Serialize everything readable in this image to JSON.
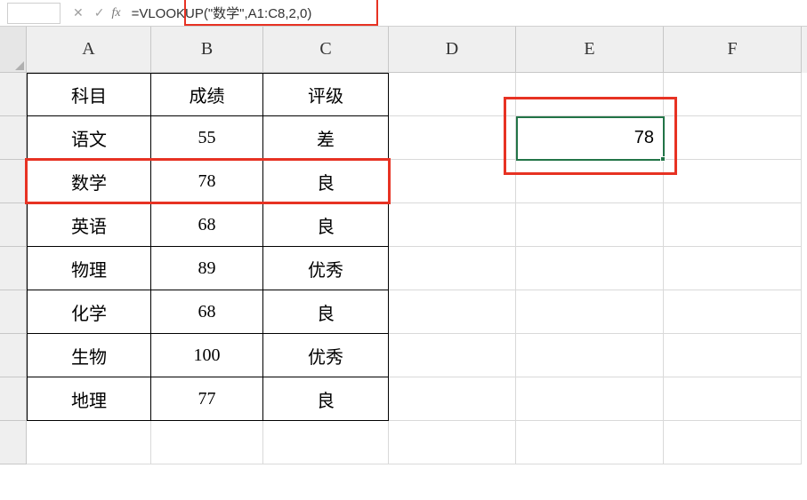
{
  "formula_bar": {
    "name_box": "",
    "formula": "=VLOOKUP(\"数学\",A1:C8,2,0)"
  },
  "columns": [
    "A",
    "B",
    "C",
    "D",
    "E",
    "F"
  ],
  "table": {
    "headers": {
      "subject": "科目",
      "score": "成绩",
      "grade": "评级"
    },
    "rows": [
      {
        "subject": "语文",
        "score": "55",
        "grade": "差"
      },
      {
        "subject": "数学",
        "score": "78",
        "grade": "良"
      },
      {
        "subject": "英语",
        "score": "68",
        "grade": "良"
      },
      {
        "subject": "物理",
        "score": "89",
        "grade": "优秀"
      },
      {
        "subject": "化学",
        "score": "68",
        "grade": "良"
      },
      {
        "subject": "生物",
        "score": "100",
        "grade": "优秀"
      },
      {
        "subject": "地理",
        "score": "77",
        "grade": "良"
      }
    ]
  },
  "result_cell": {
    "address": "E2",
    "value": "78"
  },
  "highlights": {
    "formula_box": true,
    "math_row": true,
    "result_box": true
  }
}
